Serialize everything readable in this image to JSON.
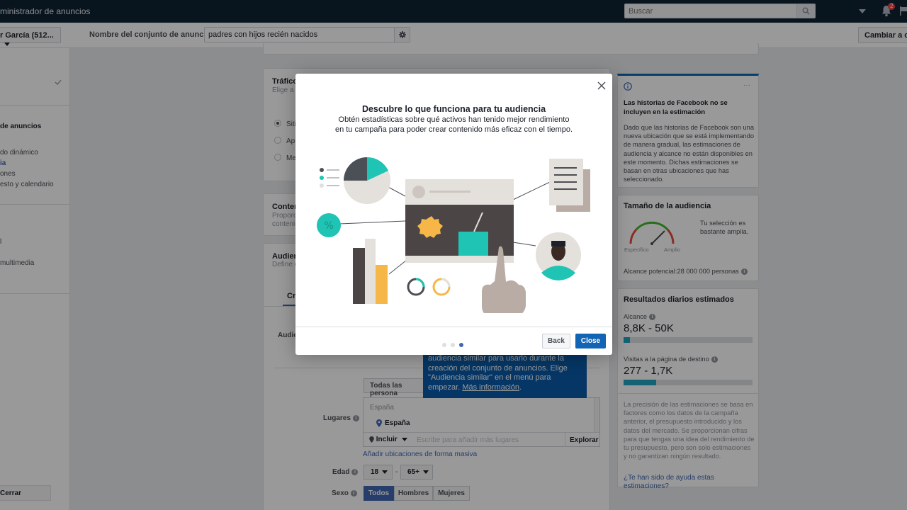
{
  "topbar": {
    "title": "ministrador de anuncios",
    "search_placeholder": "Buscar",
    "notification_count": "2"
  },
  "subbar": {
    "account": "r García (512...",
    "adset_label": "Nombre del conjunto de anuncios",
    "adset_value": "padres con hijos recién nacidos",
    "change_button": "Cambiar a cre"
  },
  "leftnav": {
    "section_ad_set": "de anuncios",
    "items": [
      "do dinámico",
      "ia",
      "ones",
      "esto y calendario"
    ],
    "item_1": "l",
    "item_multimedia": "multimedia",
    "close_button": "Cerrar"
  },
  "main": {
    "traffic_title": "Tráfico",
    "traffic_subtitle": "Elige a c",
    "traffic_options": [
      "Siti",
      "Apli",
      "Mer"
    ],
    "content_title": "Conter",
    "content_sub1": "Proporc",
    "content_sub2": "contenio",
    "audience_title": "Audien",
    "audience_sub": "Define q",
    "audience_tab": "Cre",
    "audience_label": "Audie",
    "all_people": "Todas las persona",
    "locations_label": "Lugares",
    "location_placeholder": "España",
    "location_selected": "España",
    "include_label": "Incluir",
    "location_search_placeholder": "Escribe para añadir más lugares",
    "explore_button": "Explorar",
    "bulk_locations": "Añadir ubicaciones de forma masiva",
    "age_label": "Edad",
    "age_min": "18",
    "age_max": "65+",
    "age_dash": "-",
    "gender_label": "Sexo",
    "gender_options": [
      "Todos",
      "Hombres",
      "Mujeres"
    ]
  },
  "tooltip": {
    "text": "audiencia similar para usarlo durante la creación del conjunto de anuncios. Elige \"Audiencia similar\" en el menú para empezar.",
    "link": "Más información",
    "tail": "."
  },
  "right": {
    "stories_title": "Las historias de Facebook no se incluyen en la estimación",
    "stories_body": "Dado que las historias de Facebook son una nueva ubicación que se está implementando de manera gradual, las estimaciones de audiencia y alcance no están disponibles en este momento. Dichas estimaciones se basan en otras ubicaciones que has seleccionado.",
    "more": "···",
    "audience_size_title": "Tamaño de la audiencia",
    "gauge_specific": "Específico",
    "gauge_broad": "Amplio",
    "gauge_text": "Tu selección es bastante amplia.",
    "potential_reach": "Alcance potencial:28 000 000 personas",
    "daily_title": "Resultados diarios estimados",
    "reach_label": "Alcance",
    "reach_value": "8,8K - 50K",
    "reach_fill": 0.05,
    "visits_label": "Visitas a la página de destino",
    "visits_value": "277 - 1,7K",
    "visits_fill": 0.25,
    "disclaimer": "La precisión de las estimaciones se basa en factores como los datos de la campaña anterior, el presupuesto introducido y los datos del mercado. Se proporcionan cifras para que tengas una idea del rendimiento de tu presupuesto, pero son solo estimaciones y no garantizan ningún resultado.",
    "help_link": "¿Te han sido de ayuda estas estimaciones?"
  },
  "modal": {
    "title": "Descubre lo que funciona para tu audiencia",
    "description": "Obtén estadísticas sobre qué activos han tenido mejor rendimiento en tu campaña para poder crear contenido más eficaz con el tiempo.",
    "back_button": "Back",
    "close_button": "Close",
    "step_total": 3,
    "step_current": 3
  },
  "colors": {
    "topbar": "#0e2434",
    "accent": "#4267b2",
    "teal": "#20c4b4",
    "primary_button": "#1264b5"
  }
}
